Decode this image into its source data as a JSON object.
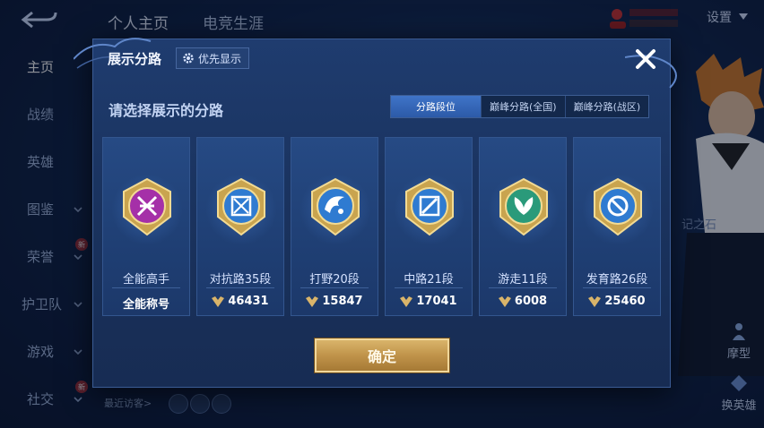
{
  "topbar": {
    "tabs": [
      "个人主页",
      "电竞生涯"
    ],
    "settings_label": "设置"
  },
  "sidebar": {
    "items": [
      {
        "label": "主页",
        "active": true
      },
      {
        "label": "战绩"
      },
      {
        "label": "英雄"
      },
      {
        "label": "图鉴",
        "chevron": true
      },
      {
        "label": "荣誉",
        "chevron": true,
        "new": "新"
      },
      {
        "label": "护卫队",
        "chevron": true
      },
      {
        "label": "游戏",
        "chevron": true
      },
      {
        "label": "社交",
        "chevron": true,
        "new": "新"
      }
    ]
  },
  "background": {
    "right_label": "记之石",
    "right_buttons": [
      "摩型",
      "换英雄"
    ],
    "recent_visitors": "最近访客>"
  },
  "modal": {
    "title": "展示分路",
    "priority_button": "优先显示",
    "subtitle": "请选择展示的分路",
    "segments": [
      "分路段位",
      "巅峰分路(全国)",
      "巅峰分路(战区)"
    ],
    "active_segment": 0,
    "cards": [
      {
        "rank": "全能高手",
        "points": "全能称号",
        "icon": "all-round-badge-icon",
        "color": "#b33bb0"
      },
      {
        "rank": "对抗路35段",
        "points": "46431",
        "icon": "clash-lane-badge-icon",
        "color": "#2f7bd1"
      },
      {
        "rank": "打野20段",
        "points": "15847",
        "icon": "jungle-badge-icon",
        "color": "#2f7bd1"
      },
      {
        "rank": "中路21段",
        "points": "17041",
        "icon": "mid-lane-badge-icon",
        "color": "#2f7bd1"
      },
      {
        "rank": "游走11段",
        "points": "6008",
        "icon": "roam-badge-icon",
        "color": "#2a9a7a"
      },
      {
        "rank": "发育路26段",
        "points": "25460",
        "icon": "farm-lane-badge-icon",
        "color": "#2f7bd1"
      }
    ],
    "confirm_label": "确定"
  }
}
